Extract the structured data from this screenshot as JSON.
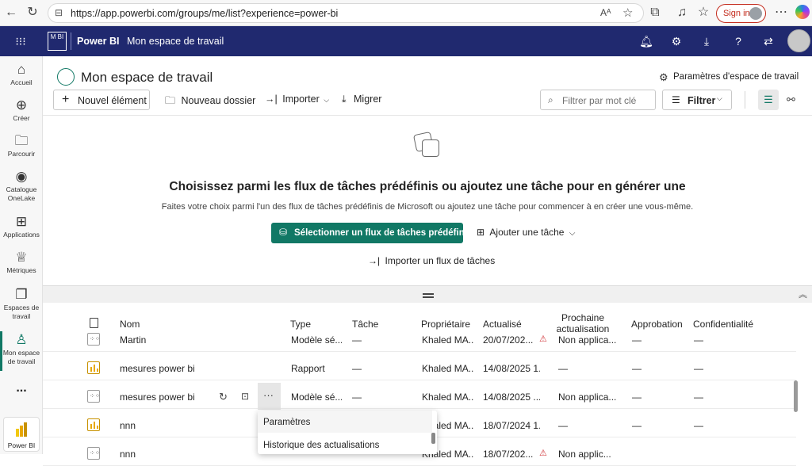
{
  "browser": {
    "url": "https://app.powerbi.com/groups/me/list?experience=power-bi",
    "sign_in": "Sign in"
  },
  "header": {
    "app_logo": "M BI",
    "app_name": "Power BI",
    "workspace": "Mon espace de travail"
  },
  "leftnav": {
    "items": [
      {
        "label": "Accueil",
        "icon": "home-icon"
      },
      {
        "label": "Créer",
        "icon": "plus-circle-icon"
      },
      {
        "label": "Parcourir",
        "icon": "folder-icon"
      },
      {
        "label": "Catalogue OneLake",
        "icon": "onelake-icon"
      },
      {
        "label": "Applications",
        "icon": "apps-icon"
      },
      {
        "label": "Métriques",
        "icon": "trophy-icon"
      },
      {
        "label": "Espaces de travail",
        "icon": "workspaces-icon"
      },
      {
        "label": "Mon espace de travail",
        "icon": "user-icon"
      }
    ],
    "more": "...",
    "footer": "Power BI"
  },
  "workspace": {
    "title": "Mon espace de travail",
    "settings": "Paramètres d'espace de travail",
    "toolbar": {
      "new_item": "Nouvel élément",
      "new_folder": "Nouveau dossier",
      "import": "Importer",
      "migrate": "Migrer",
      "filter_placeholder": "Filtrer par mot clé",
      "filter": "Filtrer"
    }
  },
  "empty_state": {
    "heading": "Choisissez parmi les flux de tâches prédéfinis ou ajoutez une tâche pour en générer une",
    "sub": "Faites votre choix parmi l'un des flux de tâches prédéfinis de Microsoft ou ajoutez une tâche pour commencer à en créer une vous-même.",
    "primary": "Sélectionner un flux de tâches prédéfini",
    "add_task": "Ajouter une tâche",
    "import_flow": "Importer un flux de tâches"
  },
  "table": {
    "columns": [
      "Nom",
      "Type",
      "Tâche",
      "Propriétaire",
      "Actualisé",
      "Prochaine actualisation",
      "Approbation",
      "Confidentialité"
    ],
    "rows": [
      {
        "name": "Martin",
        "type": "Modèle sé...",
        "task": "—",
        "owner": "Khaled MA...",
        "updated": "20/07/202...",
        "next": "Non applica...",
        "approval": "—",
        "conf": "—",
        "kind": "model",
        "warn": true
      },
      {
        "name": "mesures power bi",
        "type": "Rapport",
        "task": "—",
        "owner": "Khaled MA...",
        "updated": "14/08/2025 1...",
        "next": "—",
        "approval": "—",
        "conf": "—",
        "kind": "report",
        "warn": false
      },
      {
        "name": "mesures power bi",
        "type": "Modèle sé...",
        "task": "—",
        "owner": "Khaled MA...",
        "updated": "14/08/2025 ...",
        "next": "Non applica...",
        "approval": "—",
        "conf": "—",
        "kind": "model",
        "warn": false
      },
      {
        "name": "nnn",
        "type": "",
        "task": "",
        "owner": "Khaled MA...",
        "updated": "18/07/2024 1...",
        "next": "—",
        "approval": "—",
        "conf": "—",
        "kind": "report",
        "warn": false
      },
      {
        "name": "nnn",
        "type": "",
        "task": "",
        "owner": "Khaled MA...",
        "updated": "18/07/202...",
        "next": "Non applic...",
        "approval": "",
        "conf": "",
        "kind": "model",
        "warn": true
      }
    ]
  },
  "context_menu": {
    "items": [
      "Paramètres",
      "Historique des actualisations"
    ]
  },
  "colors": {
    "header": "#20296f",
    "accent": "#117865"
  }
}
